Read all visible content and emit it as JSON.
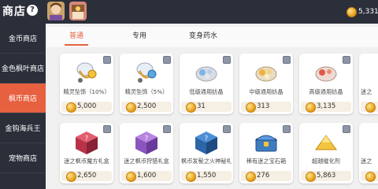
{
  "header": {
    "title": "商店",
    "balance": "5,331",
    "colors": {
      "bar": "#2b2f3a",
      "accent": "#e7603f"
    }
  },
  "sidebar": {
    "items": [
      {
        "label": "金币商店"
      },
      {
        "label": "金色枫叶商店"
      },
      {
        "label": "枫币商店",
        "active": true
      },
      {
        "label": "金钩海兵王"
      },
      {
        "label": "宠物商店"
      }
    ]
  },
  "tabs": [
    {
      "label": "普通",
      "active": true
    },
    {
      "label": "专用"
    },
    {
      "label": "变身药水"
    }
  ],
  "items": [
    {
      "name": "精灵坠饰（10%）",
      "price": "5,000",
      "icon": "pendant-icon"
    },
    {
      "name": "精灵坠饰（5%）",
      "price": "2,500",
      "icon": "pendant-icon"
    },
    {
      "name": "低级通用纺晶",
      "price": "31",
      "icon": "crystal-icon"
    },
    {
      "name": "中级通用纺晶",
      "price": "313",
      "icon": "crystal-icon"
    },
    {
      "name": "高级通用纺晶",
      "price": "3,135",
      "icon": "crystal-icon"
    },
    {
      "name": "迷之",
      "price": "",
      "icon": "box-icon"
    },
    {
      "name": "迷之枫币魔方礼盒",
      "price": "2,650",
      "icon": "cube-box-icon"
    },
    {
      "name": "迷之枫币狩猎礼盒",
      "price": "1,600",
      "icon": "cube-box-icon"
    },
    {
      "name": "枫币发髻之火神秘礼盒",
      "price": "1,550",
      "icon": "cube-box-icon"
    },
    {
      "name": "稀有迷之宝石箱",
      "price": "276",
      "icon": "chest-icon"
    },
    {
      "name": "超越催化剂",
      "price": "5,863",
      "icon": "powder-icon"
    },
    {
      "name": "迷之",
      "price": "",
      "icon": "box-icon"
    }
  ]
}
